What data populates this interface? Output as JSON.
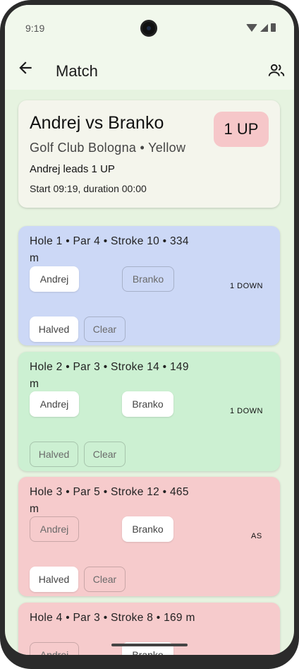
{
  "status_bar": {
    "time": "9:19"
  },
  "app_bar": {
    "title": "Match"
  },
  "summary": {
    "title": "Andrej vs Branko",
    "course": "Golf Club Bologna • Yellow",
    "status_line": "Andrej leads 1 UP",
    "start_line": "Start 09:19, duration 00:00",
    "score_badge": "1 UP"
  },
  "holes": [
    {
      "title": "Hole 1 • Par 4 • Stroke 10 • 334 m",
      "player_a": "Andrej",
      "player_b": "Branko",
      "halved": "Halved",
      "clear": "Clear",
      "state": "1 DOWN",
      "color": "#ccd8f6"
    },
    {
      "title": "Hole 2 • Par 3 • Stroke 14 • 149 m",
      "player_a": "Andrej",
      "player_b": "Branko",
      "halved": "Halved",
      "clear": "Clear",
      "state": "1 DOWN",
      "color": "#ccf0d2"
    },
    {
      "title": "Hole 3 • Par 5 • Stroke 12 • 465 m",
      "player_a": "Andrej",
      "player_b": "Branko",
      "halved": "Halved",
      "clear": "Clear",
      "state": "AS",
      "color": "#f6cbcc"
    },
    {
      "title": "Hole 4 • Par 3 • Stroke 8 • 169 m",
      "player_a": "Andrej",
      "player_b": "Branko",
      "color": "#f6cbcc"
    }
  ],
  "icons": [
    "back-arrow-icon",
    "people-icon",
    "wifi-icon",
    "signal-icon",
    "battery-icon"
  ]
}
